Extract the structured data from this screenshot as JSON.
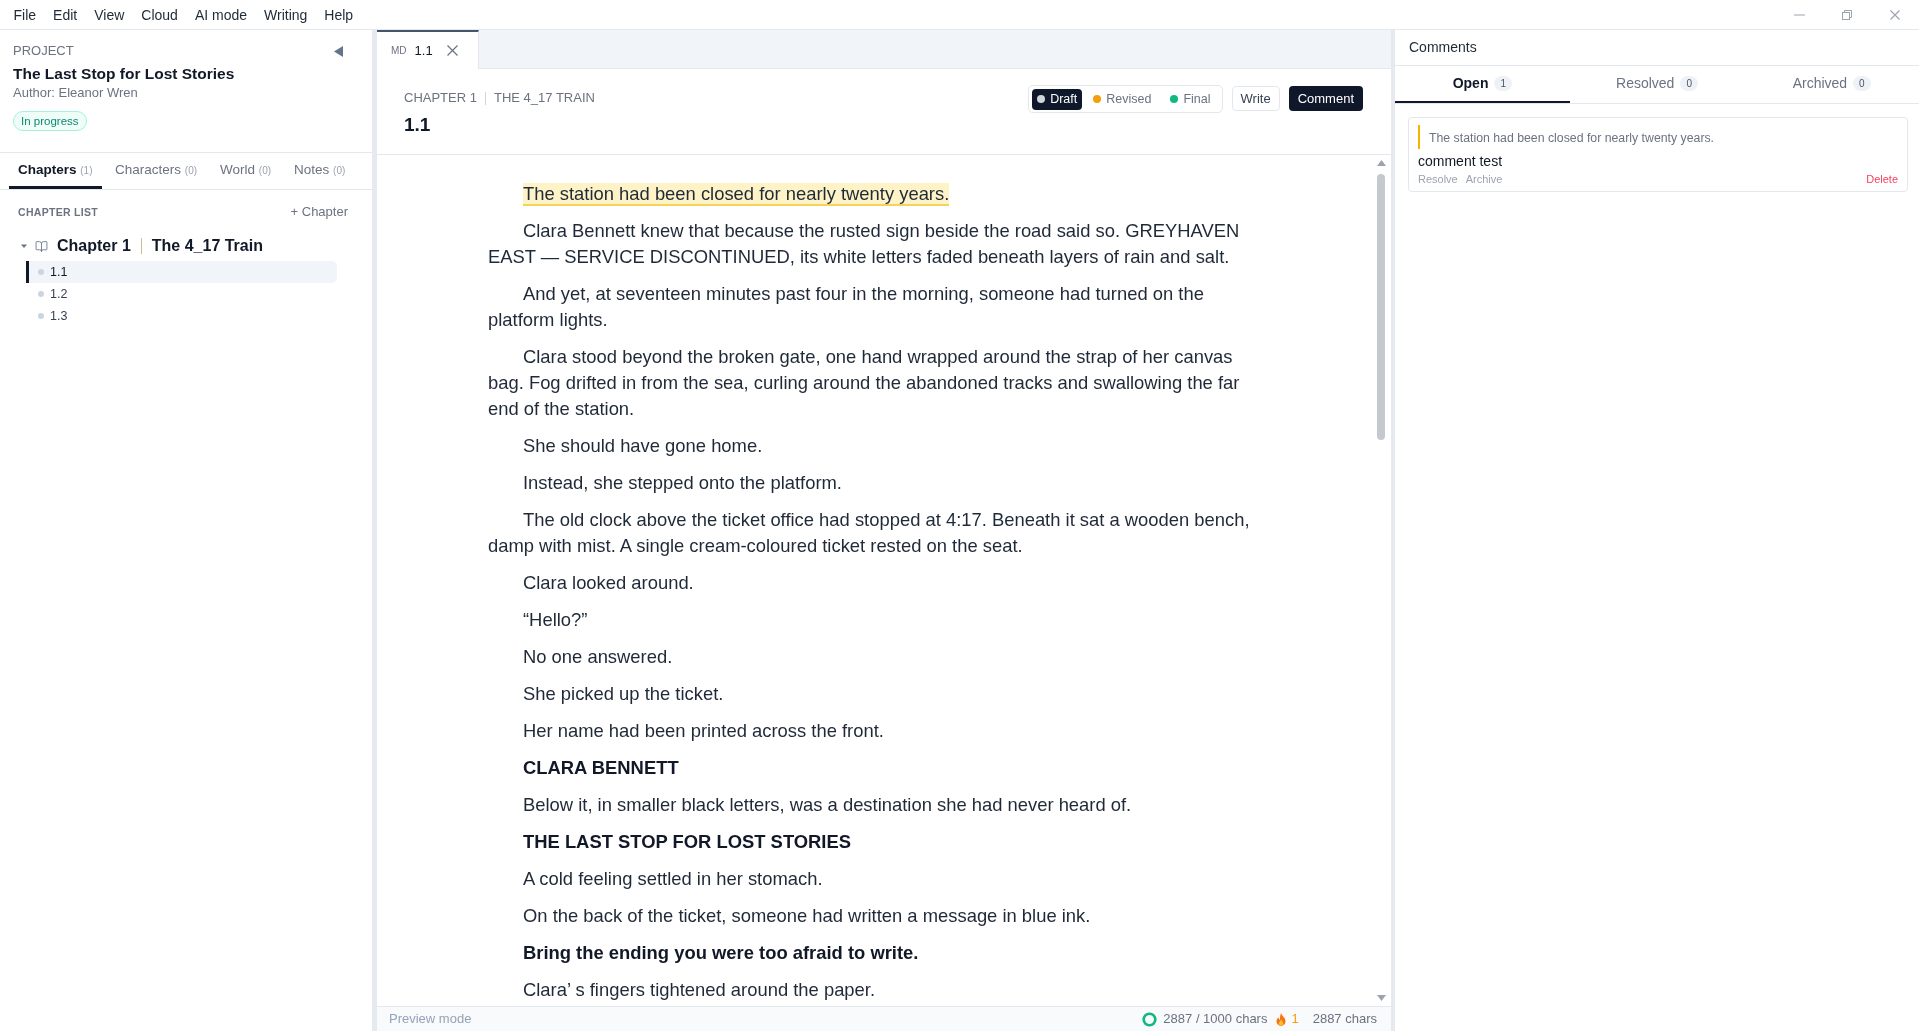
{
  "menu": [
    "File",
    "Edit",
    "View",
    "Cloud",
    "AI mode",
    "Writing",
    "Help"
  ],
  "project": {
    "label": "PROJECT",
    "title": "The Last Stop for Lost Stories",
    "author": "Author: Eleanor Wren",
    "status": "In progress"
  },
  "sidebar_tabs": [
    {
      "label": "Chapters",
      "count": "(1)",
      "selected": true
    },
    {
      "label": "Characters",
      "count": "(0)",
      "selected": false
    },
    {
      "label": "World",
      "count": "(0)",
      "selected": false
    },
    {
      "label": "Notes",
      "count": "(0)",
      "selected": false
    }
  ],
  "chapter_list": {
    "heading": "CHAPTER LIST",
    "add_button": "+ Chapter",
    "chapters": [
      {
        "number": "Chapter 1",
        "title": "The 4_17 Train",
        "expanded": true,
        "children": [
          {
            "label": "1.1",
            "selected": true
          },
          {
            "label": "1.2",
            "selected": false
          },
          {
            "label": "1.3",
            "selected": false
          }
        ]
      }
    ]
  },
  "editor": {
    "tabs": [
      {
        "badge": "MD",
        "label": "1.1",
        "selected": true
      }
    ],
    "breadcrumb": [
      "CHAPTER 1",
      "THE 4_17 TRAIN"
    ],
    "title": "1.1",
    "statuses": [
      {
        "label": "Draft",
        "color": "#d1d5db",
        "selected": true
      },
      {
        "label": "Revised",
        "color": "#f59e0b",
        "selected": false
      },
      {
        "label": "Final",
        "color": "#10b981",
        "selected": false
      }
    ],
    "modes": [
      {
        "label": "Write",
        "selected": false
      },
      {
        "label": "Comment",
        "selected": true
      }
    ],
    "paragraphs": [
      {
        "kind": "highlight",
        "text": "The station had been closed for nearly twenty years."
      },
      {
        "kind": "plain",
        "text": "Clara Bennett knew that because the rusted sign beside the road said so. GREYHAVEN EAST — SERVICE DISCONTINUED, its white letters faded beneath layers of rain and salt."
      },
      {
        "kind": "plain",
        "text": "And yet, at seventeen minutes past four in the morning, someone had turned on the platform lights."
      },
      {
        "kind": "plain",
        "text": "Clara stood beyond the broken gate, one hand wrapped around the strap of her canvas bag. Fog drifted in from the sea, curling around the abandoned tracks and swallowing the far end of the station."
      },
      {
        "kind": "plain",
        "text": "She should have gone home."
      },
      {
        "kind": "plain",
        "text": "Instead, she stepped onto the platform."
      },
      {
        "kind": "plain",
        "text": "The old clock above the ticket office had stopped at 4:17. Beneath it sat a wooden bench, damp with mist. A single cream-coloured ticket rested on the seat."
      },
      {
        "kind": "plain",
        "text": "Clara looked around."
      },
      {
        "kind": "plain",
        "text": "“Hello?”"
      },
      {
        "kind": "plain",
        "text": "No one answered."
      },
      {
        "kind": "plain",
        "text": "She picked up the ticket."
      },
      {
        "kind": "plain",
        "text": "Her name had been printed across the front."
      },
      {
        "kind": "bold",
        "text": "CLARA BENNETT"
      },
      {
        "kind": "plain",
        "text": "Below it, in smaller black letters, was a destination she had never heard of."
      },
      {
        "kind": "bold",
        "text": "THE LAST STOP FOR LOST STORIES"
      },
      {
        "kind": "plain",
        "text": "A cold feeling settled in her stomach."
      },
      {
        "kind": "plain",
        "text": "On the back of the ticket, someone had written a message in blue ink."
      },
      {
        "kind": "bold",
        "text": "Bring the ending you were too afraid to write."
      },
      {
        "kind": "plain",
        "text": "Clara’ s fingers tightened around the paper."
      }
    ]
  },
  "status_bar": {
    "mode": "Preview mode",
    "goal": {
      "label": "2887 / 1000 chars",
      "level": 1
    },
    "streak": "1",
    "total": "2887 chars"
  },
  "comments_panel": {
    "title": "Comments",
    "tabs": [
      {
        "label": "Open",
        "count": "1",
        "selected": true
      },
      {
        "label": "Resolved",
        "count": "0",
        "selected": false
      },
      {
        "label": "Archived",
        "count": "0",
        "selected": false
      }
    ],
    "comments": [
      {
        "quote": "The station had been closed for nearly twenty years.",
        "text": "comment test",
        "actions": [
          "Resolve",
          "Archive"
        ],
        "delete": "Delete"
      }
    ]
  }
}
